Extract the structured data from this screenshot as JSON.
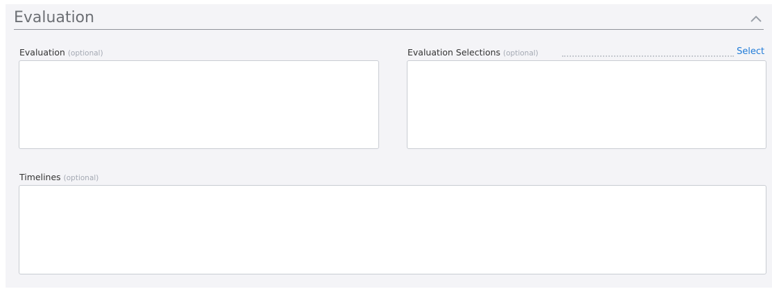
{
  "section": {
    "title": "Evaluation"
  },
  "fields": {
    "evaluation": {
      "label": "Evaluation",
      "optional": "(optional)",
      "value": ""
    },
    "evaluation_selections": {
      "label": "Evaluation Selections",
      "optional": "(optional)",
      "value": "",
      "select_label": "Select"
    },
    "timelines": {
      "label": "Timelines",
      "optional": "(optional)",
      "value": ""
    }
  },
  "icons": {
    "collapse": "chevron-up-icon"
  },
  "colors": {
    "panel_bg": "#f4f4f7",
    "link": "#1f7bd8",
    "optional_text": "#a4a9b3"
  }
}
